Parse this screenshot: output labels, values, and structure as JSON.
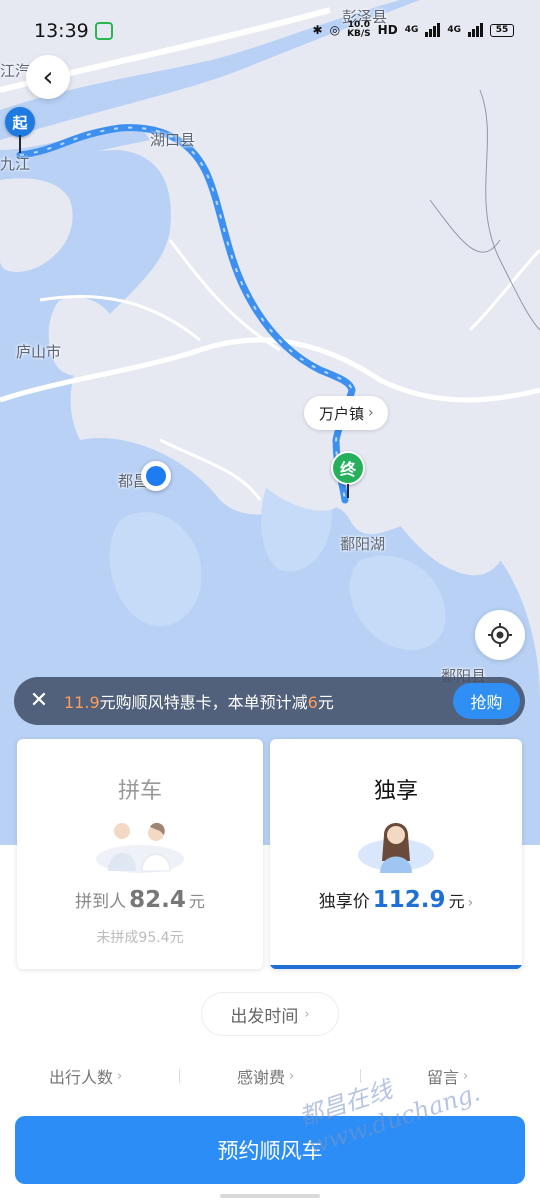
{
  "status_bar": {
    "time": "13:39",
    "net_speed_value": "10.0",
    "net_speed_unit": "KB/S",
    "hd_label": "HD",
    "net1": "4G",
    "net2": "4G",
    "battery": "55"
  },
  "map": {
    "labels": {
      "pengze": "彭泽县",
      "hukou": "湖口县",
      "lushan": "庐山市",
      "poyang_lake": "鄱阳湖",
      "poyang_county": "鄱阳县",
      "duchang": "都昌",
      "jiujiang": "九江",
      "jiujiang_station": "江汽车"
    },
    "start_pin": "起",
    "end_pin": "终",
    "destination": "万户镇"
  },
  "promo": {
    "price": "11.9",
    "text_mid": "元购顺风特惠卡，本单预计减",
    "discount": "6",
    "text_end": "元",
    "button": "抢购"
  },
  "cards": {
    "pool": {
      "title": "拼车",
      "price_label": "拼到人",
      "price": "82.4",
      "unit": "元",
      "fallback": "未拼成95.4元"
    },
    "solo": {
      "title": "独享",
      "price_label": "独享价",
      "price": "112.9",
      "unit": "元",
      "selected": true
    }
  },
  "depart_time": "出发时间",
  "options": {
    "passengers": "出行人数",
    "thanks_fee": "感谢费",
    "message": "留言"
  },
  "book_button": "预约顺风车",
  "watermark": {
    "line1": "都昌在线",
    "line2": "www.duchang."
  },
  "colors": {
    "accent": "#2b8df5",
    "route": "#3d8ff0",
    "start_pin": "#1f7ae0",
    "end_pin": "#27b05b",
    "promo_highlight": "#ff9c59"
  }
}
